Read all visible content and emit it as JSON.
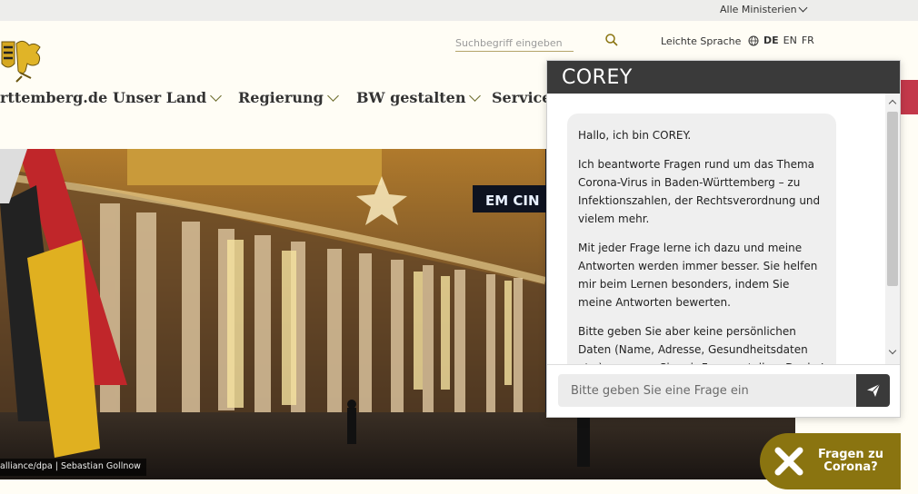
{
  "topbar": {
    "ministerien_label": "Alle Ministerien"
  },
  "header": {
    "search_placeholder": "Suchbegriff eingeben",
    "leichte_sprache": "Leichte Sprache",
    "languages": {
      "de": "DE",
      "en": "EN",
      "fr": "FR",
      "active": "DE"
    }
  },
  "nav": {
    "site_name": "rttemberg.de",
    "items": [
      {
        "label": "Unser Land"
      },
      {
        "label": "Regierung"
      },
      {
        "label": "BW gestalten"
      },
      {
        "label": "Service"
      }
    ]
  },
  "hero": {
    "caption": "alliance/dpa | Sebastian Gollnow",
    "sign_text": "EM CIN"
  },
  "chat": {
    "title": "COREY",
    "messages": [
      "Hallo, ich bin COREY.",
      "Ich beantworte Fragen rund um das Thema Corona-Virus in Baden-Württemberg – zu Infektionszahlen, der Rechtsverordnung und vielem mehr.",
      "Mit jeder Frage lerne ich dazu und meine Antworten werden immer besser. Sie helfen mir beim Lernen besonders, indem Sie meine Antworten bewerten.",
      "Bitte geben Sie aber keine persönlichen Daten (Name, Adresse, Gesundheitsdaten etc.) an, wenn Sie mir Fragen stellen. Danke! Zu den"
    ],
    "input_placeholder": "Bitte geben Sie eine Frage ein"
  },
  "corona_button": {
    "line1": "Fragen zu",
    "line2": "Corona?"
  },
  "colors": {
    "brand_gold": "#8a7410",
    "chat_header": "#3a3a3a",
    "accent_red": "#c3384a",
    "page_bg": "#fffdf5"
  }
}
